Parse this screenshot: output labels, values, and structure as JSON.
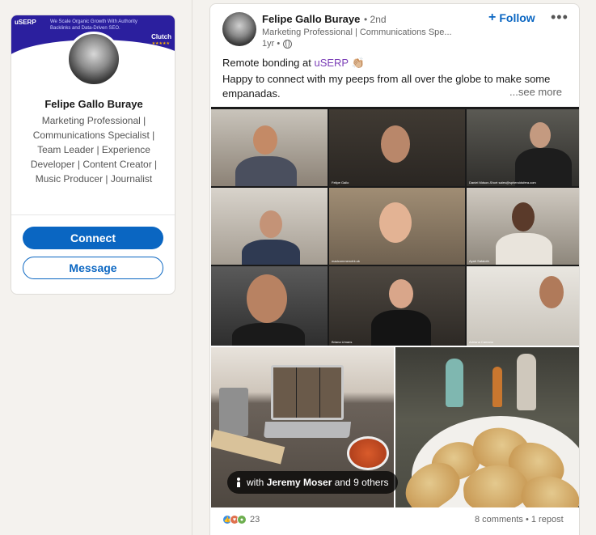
{
  "profile": {
    "banner_brand": "uSERP",
    "banner_tagline": "We Scale Organic Growth With Authority Backlinks and Data-Driven SEO.",
    "banner_badge": "Clutch",
    "banner_stars": "★★★★★",
    "name": "Felipe Gallo Buraye",
    "headline": "Marketing Professional | Communications Specialist | Team Leader | Experience Developer | Content Creator | Music Producer | Journalist",
    "connect_label": "Connect",
    "message_label": "Message"
  },
  "post": {
    "author_name": "Felipe Gallo Buraye",
    "degree": "• 2nd",
    "author_subtitle": "Marketing Professional | Communications Spe...",
    "timestamp": "1yr •",
    "follow_plus": "+",
    "follow_label": "Follow",
    "more_label": "•••",
    "text_prefix": "Remote bonding at ",
    "text_mention": "uSERP",
    "text_emoji": "👏🏼",
    "text_line2": "Happy to connect with my peeps from all over the globe to make some empanadas.",
    "see_more": "...see more",
    "tag_prefix": "with ",
    "tag_person": "Jeremy Moser",
    "tag_suffix": " and 9 others",
    "zoom_labels": [
      "Felipe Gallo",
      "Daniel Mdson-Short sales@spheroidsfera.com",
      "madcommenctrk.uk",
      "Ayah Safaloth",
      "Briana Umans",
      "Adriana Camano"
    ],
    "reaction_count": "23",
    "stats": "8 comments • 1 repost"
  },
  "colors": {
    "accent": "#0a66c2",
    "mention": "#7b3fb7",
    "background": "#f4f2ee"
  }
}
